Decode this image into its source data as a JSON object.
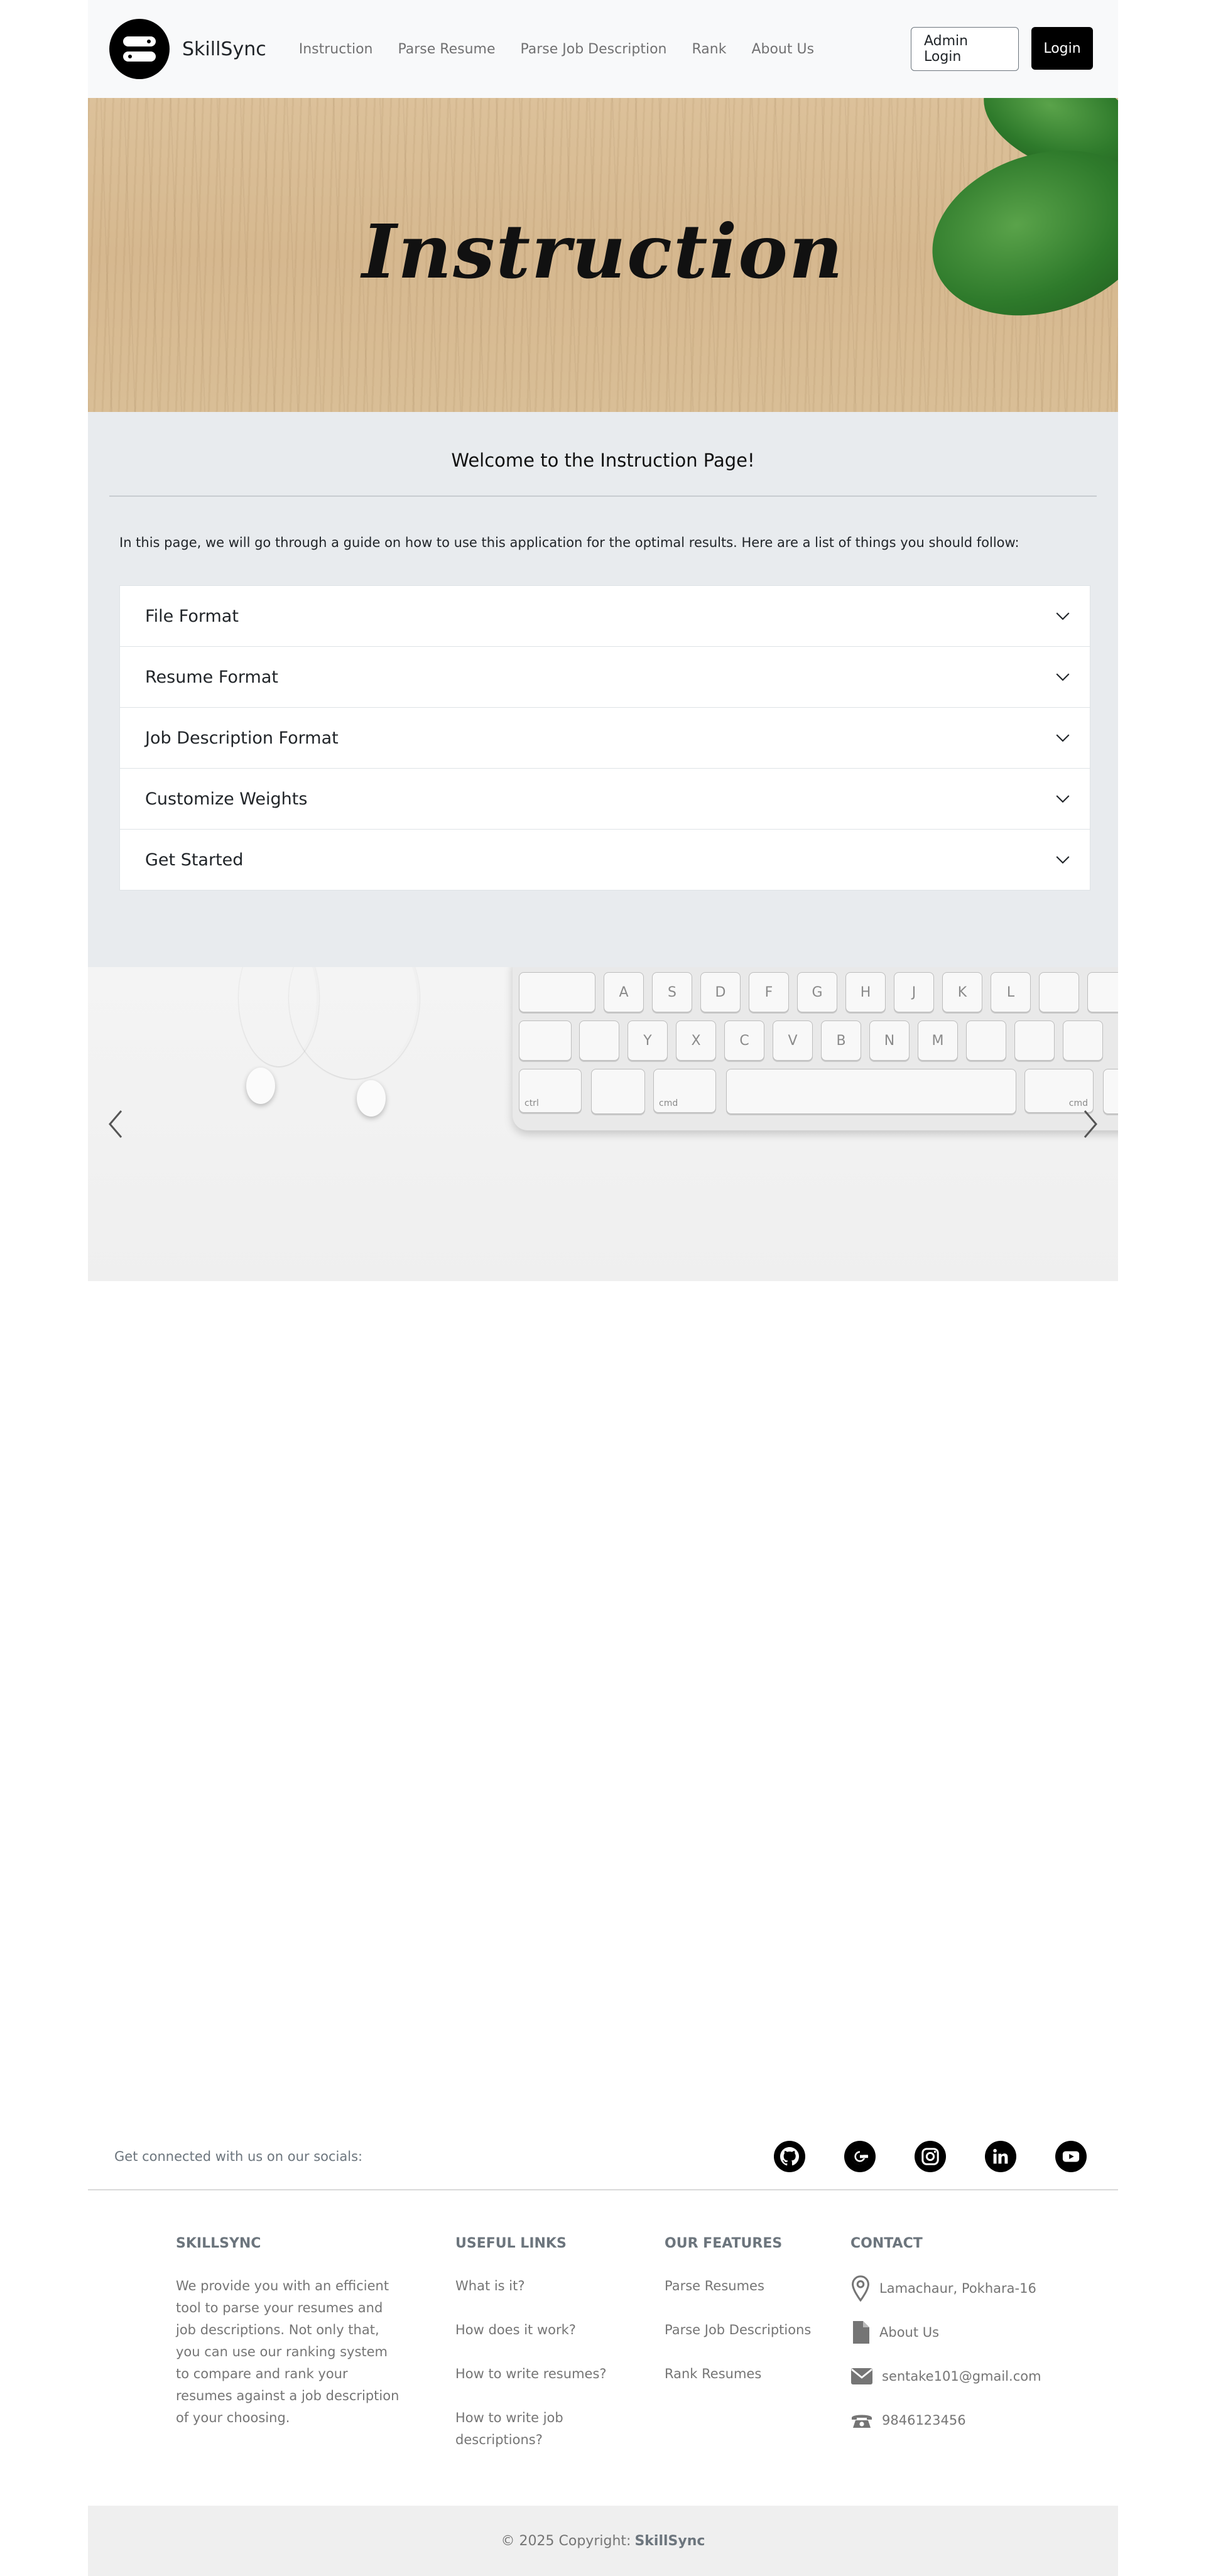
{
  "app": {
    "name": "SkillSync"
  },
  "nav": {
    "links": [
      "Instruction",
      "Parse Resume",
      "Parse Job Description",
      "Rank",
      "About Us"
    ],
    "admin_login": "Admin Login",
    "login": "Login"
  },
  "hero": {
    "title": "Instruction"
  },
  "instructions": {
    "heading": "Welcome to the Instruction Page!",
    "intro": "In this page, we will go through a guide on how to use this application for the optimal results. Here are a list of things you should follow:",
    "items": [
      "File Format",
      "Resume Format",
      "Job Description Format",
      "Customize Weights",
      "Get Started"
    ]
  },
  "carousel": {
    "keyboard_keys": [
      "A",
      "S",
      "D",
      "F",
      "G",
      "H",
      "J",
      "K",
      "L",
      "Y",
      "X",
      "C",
      "V",
      "B",
      "N",
      "M",
      "ctrl",
      "cmd",
      "cmd"
    ]
  },
  "footer": {
    "social_text": "Get connected with us on our socials:",
    "socials": [
      "github-icon",
      "google-icon",
      "instagram-icon",
      "linkedin-icon",
      "youtube-icon"
    ],
    "about_heading": "SKILLSYNC",
    "about_text": "We provide you with an efficient tool to parse your resumes and job descriptions. Not only that, you can use our ranking system to compare and rank your resumes against a job description of your choosing.",
    "useful_heading": "USEFUL LINKS",
    "useful_links": [
      "What is it?",
      "How does it work?",
      "How to write resumes?",
      "How to write job descriptions?"
    ],
    "features_heading": "OUR FEATURES",
    "features": [
      "Parse Resumes",
      "Parse Job Descriptions",
      "Rank Resumes"
    ],
    "contact_heading": "CONTACT",
    "contact": {
      "address": "Lamachaur, Pokhara-16",
      "about": "About Us",
      "email": "sentake101@gmail.com",
      "phone": "9846123456"
    },
    "copyright_prefix": "© 2025 Copyright:",
    "copyright_brand": "SkillSync"
  }
}
